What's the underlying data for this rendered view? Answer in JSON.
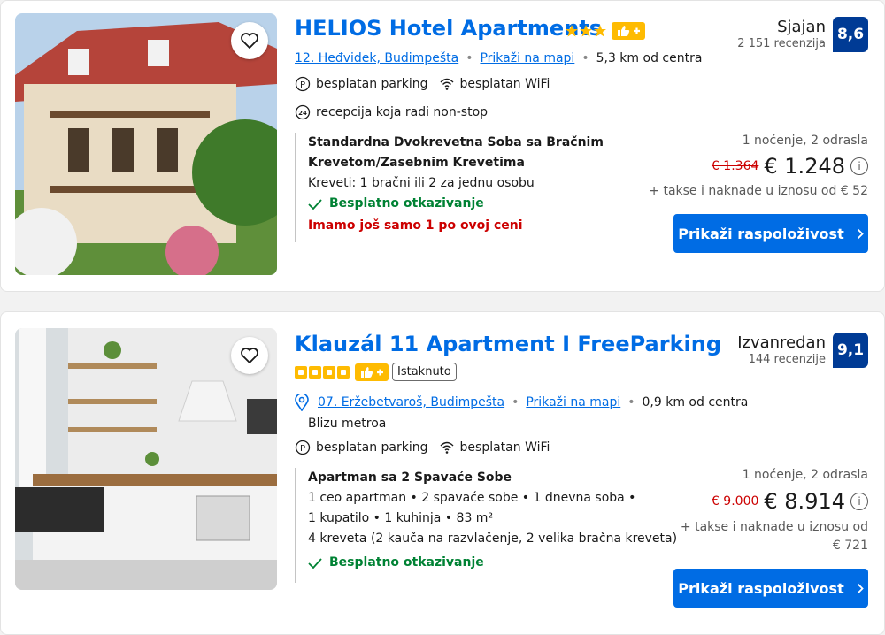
{
  "listings": [
    {
      "title": "HELIOS Hotel Apartments",
      "stars": 3,
      "address": "12. Heđvidek, Budimpešta",
      "map": "Prikaži na mapi",
      "distance": "5,3 km od centra",
      "facilities": [
        "besplatan parking",
        "besplatan WiFi"
      ],
      "reception": "recepcija koja radi non-stop",
      "room_name_1": "Standardna Dvokrevetna Soba sa Bračnim",
      "room_name_2": "Krevetom/Zasebnim Krevetima",
      "beds": "Kreveti: 1 bračni ili 2 za jednu osobu",
      "cancel": "Besplatno otkazivanje",
      "urgent": "Imamo još samo 1 po ovoj ceni",
      "rating_word": "Sjajan",
      "reviews": "2 151 recenzija",
      "score": "8,6",
      "occupancy": "1 noćenje, 2 odrasla",
      "old_price": "€ 1.364",
      "price": "€ 1.248",
      "taxes": "+ takse i naknade u iznosu od € 52",
      "button": "Prikaži raspoloživost"
    },
    {
      "title": "Klauzál 11 Apartment I FreeParking",
      "squares": 4,
      "featured": "Istaknuto",
      "address": "07. Eržebetvaroš, Budimpešta",
      "map": "Prikaži na mapi",
      "distance": "0,9 km od centra",
      "metro": "Blizu metroa",
      "facilities": [
        "besplatan parking",
        "besplatan WiFi"
      ],
      "room_name": "Apartman sa 2 Spavaće Sobe",
      "detail_1": "1 ceo apartman • 2 spavaće sobe • 1 dnevna soba •",
      "detail_2": "1 kupatilo • 1 kuhinja • 83 m²",
      "detail_3": "4 kreveta (2 kauča na razvlačenje, 2 velika bračna kreveta)",
      "cancel": "Besplatno otkazivanje",
      "rating_word": "Izvanredan",
      "reviews": "144 recenzije",
      "score": "9,1",
      "occupancy": "1 noćenje, 2 odrasla",
      "old_price": "€ 9.000",
      "price": "€ 8.914",
      "taxes_1": "+ takse i naknade u iznosu od",
      "taxes_2": "€ 721",
      "button": "Prikaži raspoloživost"
    }
  ],
  "colors": {
    "brand_blue": "#006ce4",
    "score_blue": "#003b95",
    "star_yellow": "#febb02",
    "green": "#008234",
    "red": "#cc0000"
  }
}
